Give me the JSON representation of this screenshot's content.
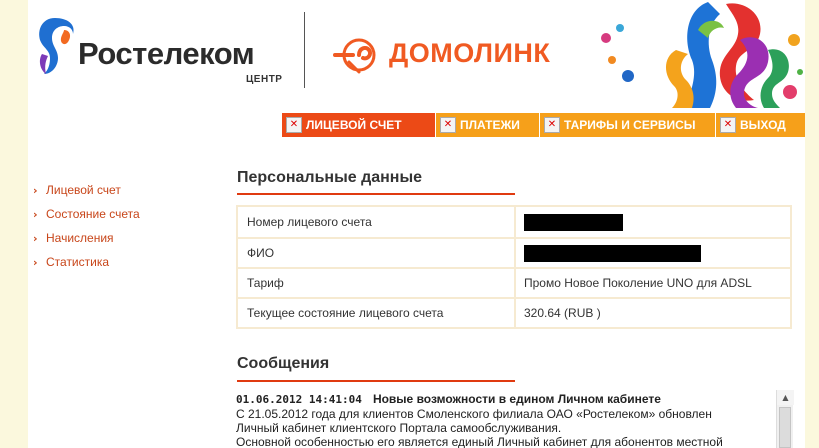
{
  "header": {
    "brand_name": "Ростелеком",
    "brand_sub": "ЦЕНТР",
    "product_name": "ДОМОЛИНК"
  },
  "nav": [
    {
      "label": "ЛИЦЕВОЙ СЧЕТ",
      "active": true
    },
    {
      "label": "ПЛАТЕЖИ",
      "active": false
    },
    {
      "label": "ТАРИФЫ И СЕРВИСЫ",
      "active": false
    },
    {
      "label": "ВЫХОД",
      "active": false
    }
  ],
  "sidebar": {
    "items": [
      {
        "label": "Лицевой счет"
      },
      {
        "label": "Состояние счета"
      },
      {
        "label": "Начисления"
      },
      {
        "label": "Статистика"
      }
    ]
  },
  "personal": {
    "title": "Персональные данные",
    "rows": [
      {
        "label": "Номер лицевого счета",
        "value": ""
      },
      {
        "label": "ФИО",
        "value": ""
      },
      {
        "label": "Тариф",
        "value": "Промо Новое Поколение UNO для ADSL"
      },
      {
        "label": "Текущее состояние лицевого счета",
        "value": "320.64  (RUB )"
      }
    ]
  },
  "messages": {
    "title": "Сообщения",
    "items": [
      {
        "datetime": "01.06.2012 14:41:04",
        "title": "Новые возможности в едином Личном кабинете",
        "lines": [
          "С 21.05.2012 года для клиентов Смоленского филиала ОАО «Ростелеком» обновлен",
          "Личный кабинет клиентского Портала самообслуживания.",
          "Основной особенностью его является единый Личный кабинет для абонентов местной"
        ]
      }
    ]
  },
  "colors": {
    "accent_orange": "#f6a01a",
    "active_tab": "#ec4a16",
    "link": "#c8461a",
    "rule": "#e03a10"
  }
}
